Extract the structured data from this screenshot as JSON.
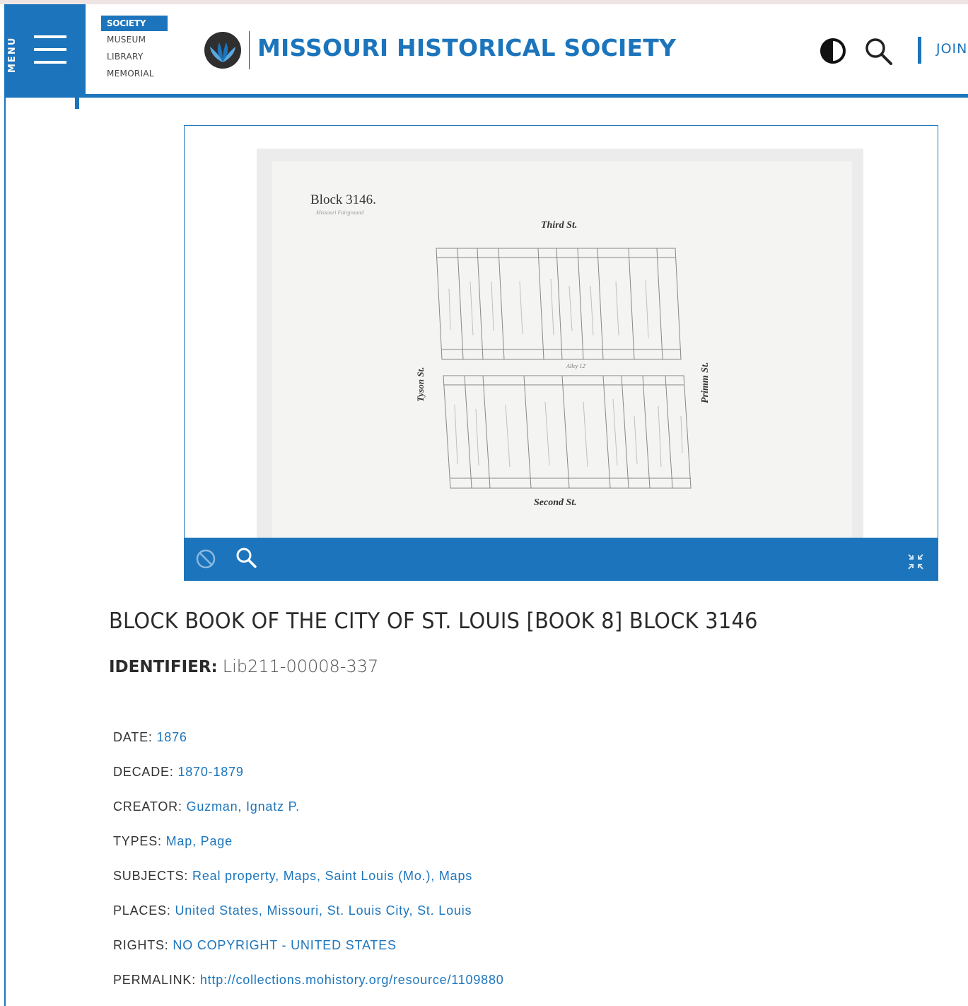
{
  "header": {
    "menu_label": "MENU",
    "sites": [
      {
        "label": "SOCIETY",
        "active": true
      },
      {
        "label": "MUSEUM",
        "active": false
      },
      {
        "label": "LIBRARY",
        "active": false
      },
      {
        "label": "MEMORIAL",
        "active": false
      }
    ],
    "brand": "MISSOURI HISTORICAL SOCIETY",
    "join_label": "JOIN",
    "icons": {
      "contrast": "contrast-icon",
      "search": "search-icon"
    }
  },
  "viewer": {
    "scan": {
      "block_label": "Block 3146.",
      "subtitle": "Missouri Fairground",
      "top_street": "Third St.",
      "bottom_street": "Second St.",
      "left_street": "Tyson St.",
      "right_street": "Primm St.",
      "alley": "Alley 12'"
    },
    "toolbar_icons": [
      "no-image-icon",
      "zoom-icon",
      "fullscreen-icon"
    ]
  },
  "record": {
    "title": "BLOCK BOOK OF THE CITY OF ST. LOUIS [BOOK 8] BLOCK 3146",
    "identifier_label": "IDENTIFIER:",
    "identifier_value": "Lib211-00008-337",
    "fields": [
      {
        "label": "DATE:",
        "links": [
          "1876"
        ]
      },
      {
        "label": "DECADE:",
        "links": [
          "1870-1879"
        ]
      },
      {
        "label": "CREATOR:",
        "links": [
          "Guzman, Ignatz P."
        ]
      },
      {
        "label": "TYPES:",
        "links": [
          "Map",
          "Page"
        ]
      },
      {
        "label": "SUBJECTS:",
        "links": [
          "Real property",
          "Maps",
          "Saint Louis (Mo.)",
          "Maps"
        ]
      },
      {
        "label": "PLACES:",
        "links": [
          "United States",
          "Missouri",
          "St. Louis City",
          "St. Louis"
        ]
      },
      {
        "label": "RIGHTS:",
        "links": [
          "NO COPYRIGHT - UNITED STATES"
        ]
      },
      {
        "label": "PERMALINK:",
        "links": [
          "http://collections.mohistory.org/resource/1109880"
        ]
      }
    ]
  },
  "colors": {
    "brand_blue": "#1c75bc",
    "text_dark": "#2b2b2b"
  }
}
